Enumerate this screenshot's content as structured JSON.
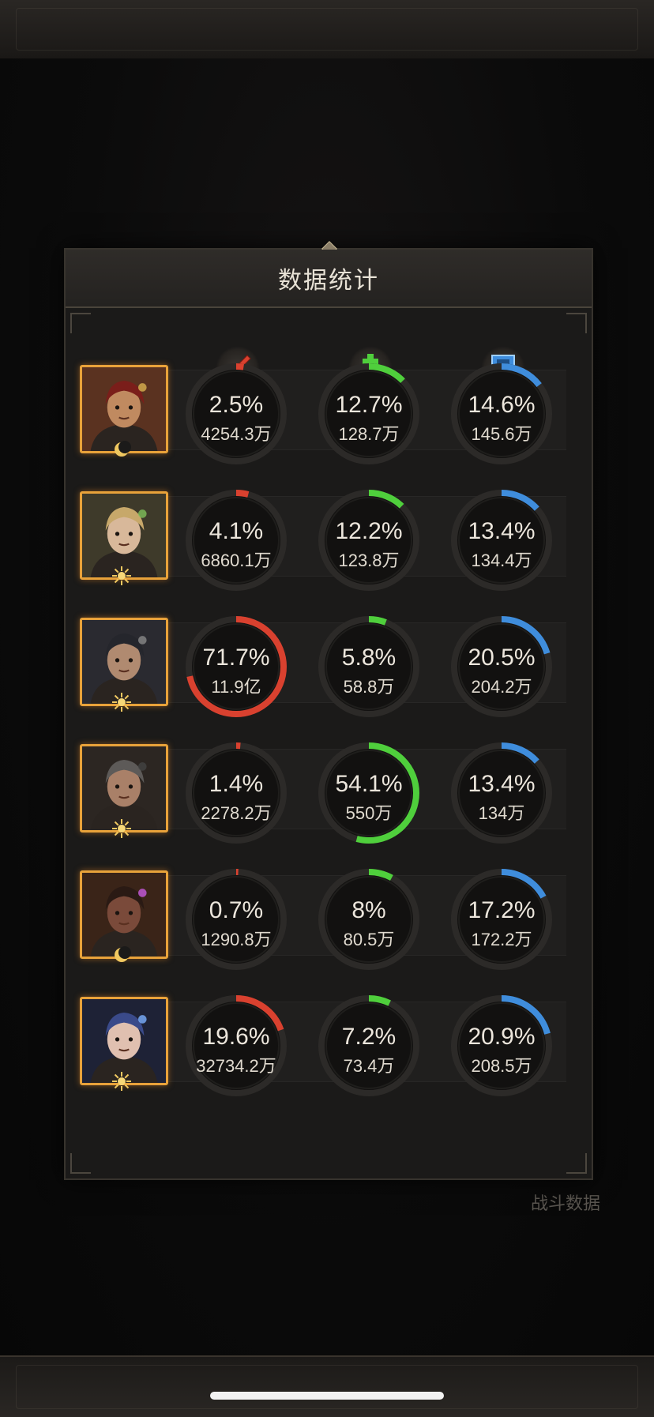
{
  "background": {
    "battle_data_label": "战斗数据"
  },
  "dialog": {
    "title": "数据统计",
    "columns": [
      {
        "icon": "sword-damage-icon",
        "color": "#d9412f"
      },
      {
        "icon": "heal-plus-icon",
        "color": "#4fcf3c"
      },
      {
        "icon": "shield-defense-icon",
        "color": "#3f8ddc"
      }
    ],
    "heroes": [
      {
        "portrait": "turbaned-warrior-portrait",
        "emblem": "crescent-moon-icon",
        "stats": [
          {
            "pct": "2.5%",
            "value": 0.025,
            "amount": "4254.3万"
          },
          {
            "pct": "12.7%",
            "value": 0.127,
            "amount": "128.7万"
          },
          {
            "pct": "14.6%",
            "value": 0.146,
            "amount": "145.6万"
          }
        ]
      },
      {
        "portrait": "blonde-priestess-portrait",
        "emblem": "sun-icon",
        "stats": [
          {
            "pct": "4.1%",
            "value": 0.041,
            "amount": "6860.1万"
          },
          {
            "pct": "12.2%",
            "value": 0.122,
            "amount": "123.8万"
          },
          {
            "pct": "13.4%",
            "value": 0.134,
            "amount": "134.4万"
          }
        ]
      },
      {
        "portrait": "dark-haired-rogue-portrait",
        "emblem": "double-sun-icon",
        "stats": [
          {
            "pct": "71.7%",
            "value": 0.717,
            "amount": "11.9亿"
          },
          {
            "pct": "5.8%",
            "value": 0.058,
            "amount": "58.8万"
          },
          {
            "pct": "20.5%",
            "value": 0.205,
            "amount": "204.2万"
          }
        ]
      },
      {
        "portrait": "grey-haired-soldier-portrait",
        "emblem": "sun-icon",
        "stats": [
          {
            "pct": "1.4%",
            "value": 0.014,
            "amount": "2278.2万"
          },
          {
            "pct": "54.1%",
            "value": 0.541,
            "amount": "550万"
          },
          {
            "pct": "13.4%",
            "value": 0.134,
            "amount": "134万"
          }
        ]
      },
      {
        "portrait": "glowing-eyed-brute-portrait",
        "emblem": "crescent-moon-icon",
        "stats": [
          {
            "pct": "0.7%",
            "value": 0.007,
            "amount": "1290.8万"
          },
          {
            "pct": "8%",
            "value": 0.08,
            "amount": "80.5万"
          },
          {
            "pct": "17.2%",
            "value": 0.172,
            "amount": "172.2万"
          }
        ]
      },
      {
        "portrait": "hooded-mage-portrait",
        "emblem": "double-sun-icon",
        "stats": [
          {
            "pct": "19.6%",
            "value": 0.196,
            "amount": "32734.2万"
          },
          {
            "pct": "7.2%",
            "value": 0.072,
            "amount": "73.4万"
          },
          {
            "pct": "20.9%",
            "value": 0.209,
            "amount": "208.5万"
          }
        ]
      }
    ]
  }
}
